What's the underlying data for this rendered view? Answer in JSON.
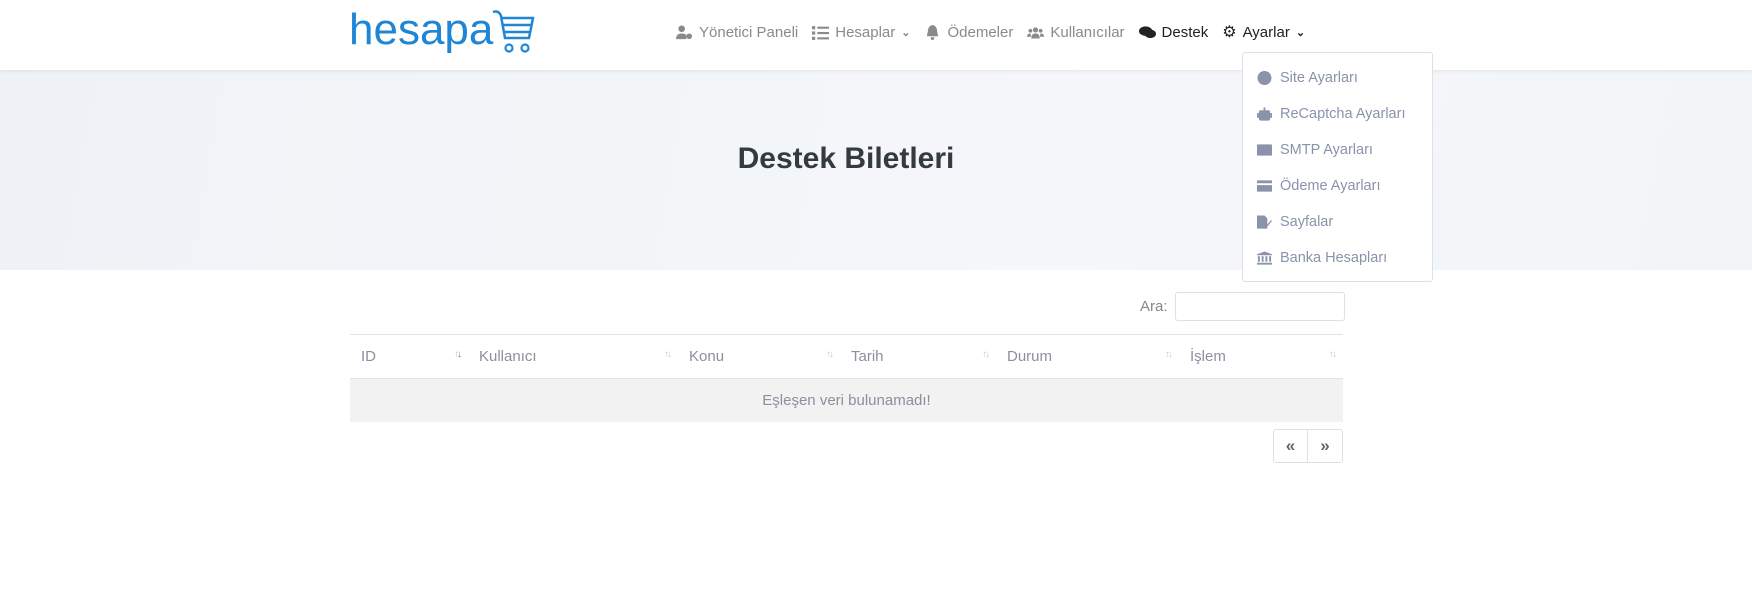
{
  "brand": {
    "logo_text": "hesapa"
  },
  "nav": {
    "items": [
      {
        "label": "Yönetici Paneli",
        "icon": "user-cog-icon"
      },
      {
        "label": "Hesaplar",
        "icon": "list-icon",
        "dropdown": true
      },
      {
        "label": "Ödemeler",
        "icon": "bell-icon"
      },
      {
        "label": "Kullanıcılar",
        "icon": "users-icon"
      },
      {
        "label": "Destek",
        "icon": "comments-icon"
      },
      {
        "label": "Ayarlar",
        "icon": "gear-icon",
        "dropdown": true
      }
    ]
  },
  "settings_menu": {
    "items": [
      {
        "label": "Site Ayarları",
        "icon": "globe-icon"
      },
      {
        "label": "ReCaptcha Ayarları",
        "icon": "robot-icon"
      },
      {
        "label": "SMTP Ayarları",
        "icon": "envelope-icon"
      },
      {
        "label": "Ödeme Ayarları",
        "icon": "credit-card-icon"
      },
      {
        "label": "Sayfalar",
        "icon": "file-edit-icon"
      },
      {
        "label": "Banka Hesapları",
        "icon": "bank-icon"
      }
    ]
  },
  "page": {
    "title": "Destek Biletleri"
  },
  "search": {
    "label": "Ara:",
    "value": ""
  },
  "table": {
    "columns": [
      "ID",
      "Kullanıcı",
      "Konu",
      "Tarih",
      "Durum",
      "İşlem"
    ],
    "empty_message": "Eşleşen veri bulunamadı!"
  },
  "pagination": {
    "prev": "«",
    "next": "»"
  }
}
